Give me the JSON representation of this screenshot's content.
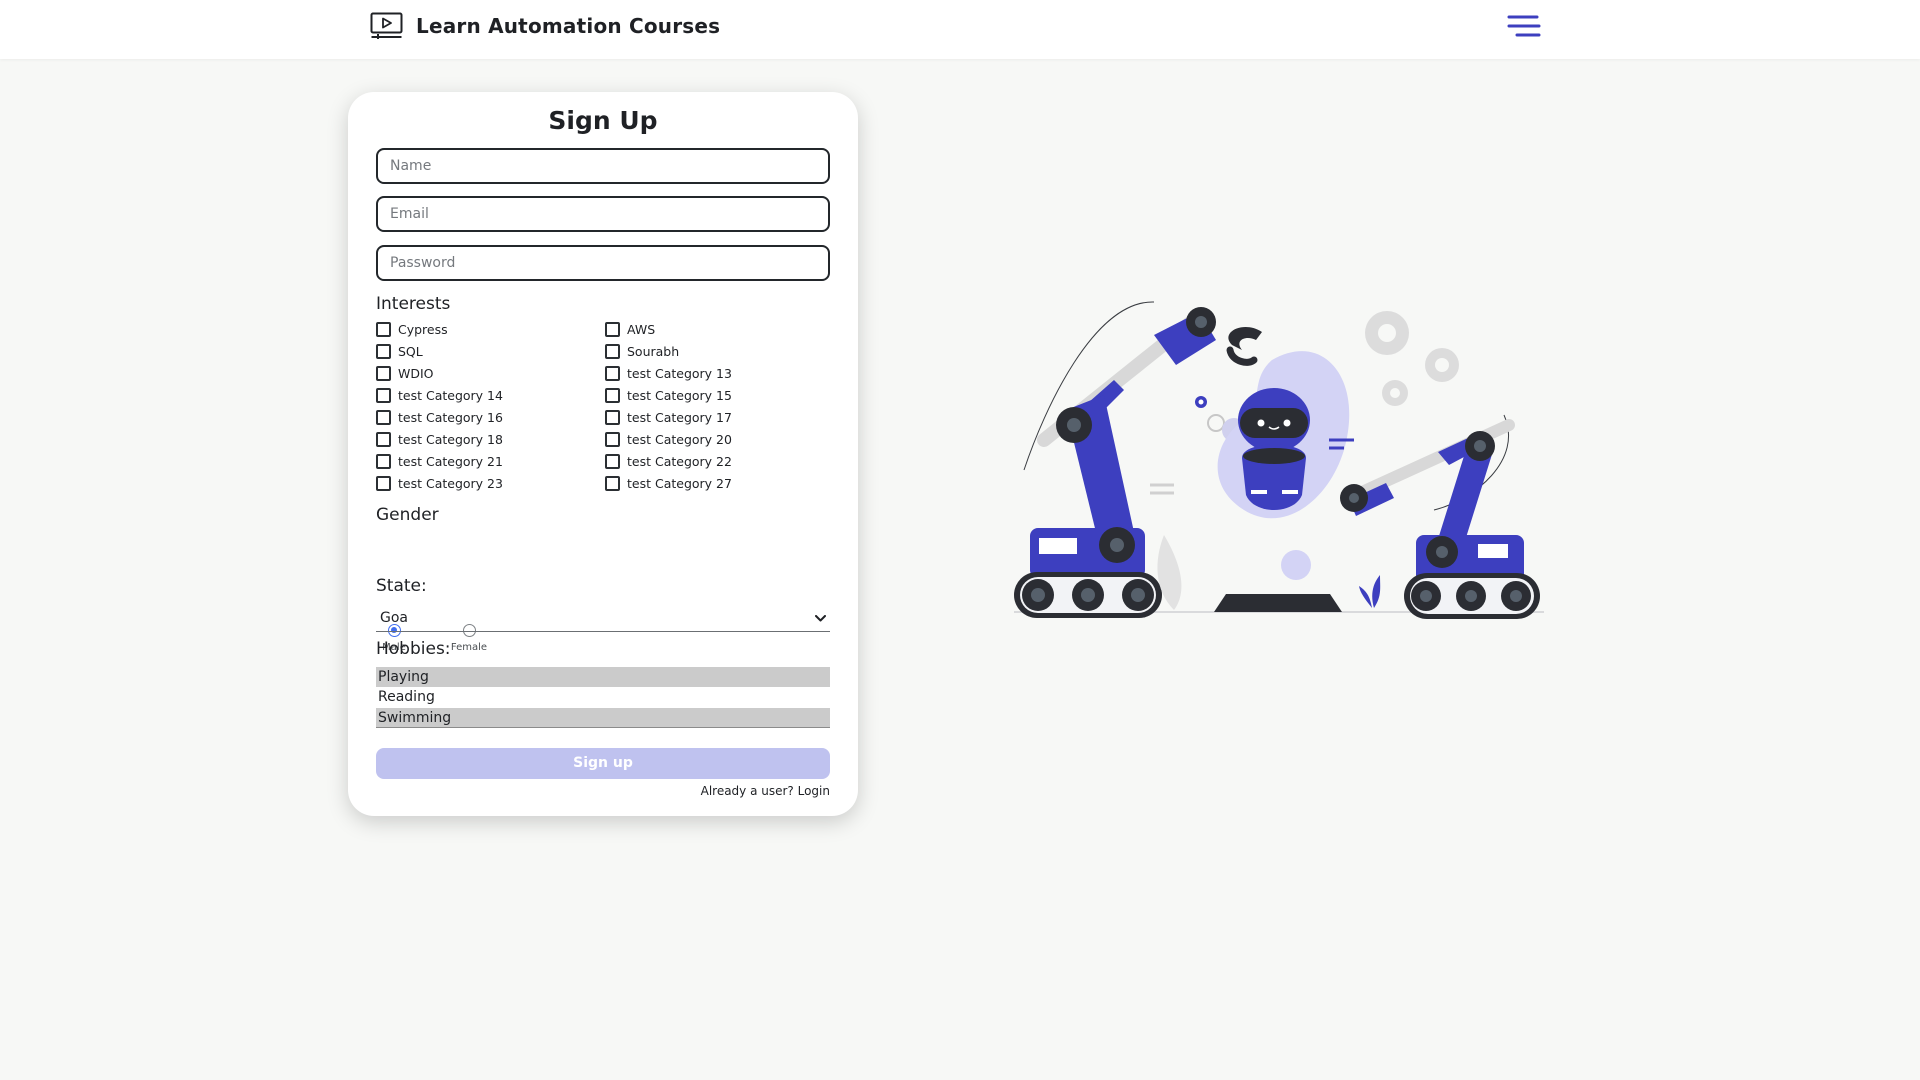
{
  "header": {
    "brand_title": "Learn Automation Courses",
    "brand_icon": "video-screen-icon",
    "menu_icon": "hamburger-icon",
    "accent_color": "#3d3fbf"
  },
  "signup": {
    "title": "Sign Up",
    "name_placeholder": "Name",
    "email_placeholder": "Email",
    "password_placeholder": "Password",
    "interests_label": "Interests",
    "interests": [
      {
        "label": "Cypress",
        "checked": false
      },
      {
        "label": "AWS",
        "checked": false
      },
      {
        "label": "SQL",
        "checked": false
      },
      {
        "label": "Sourabh",
        "checked": false
      },
      {
        "label": "WDIO",
        "checked": false
      },
      {
        "label": "test Category 13",
        "checked": false
      },
      {
        "label": "test Category 14",
        "checked": false
      },
      {
        "label": "test Category 15",
        "checked": false
      },
      {
        "label": "test Category 16",
        "checked": false
      },
      {
        "label": "test Category 17",
        "checked": false
      },
      {
        "label": "test Category 18",
        "checked": false
      },
      {
        "label": "test Category 20",
        "checked": false
      },
      {
        "label": "test Category 21",
        "checked": false
      },
      {
        "label": "test Category 22",
        "checked": false
      },
      {
        "label": "test Category 23",
        "checked": false
      },
      {
        "label": "test Category 27",
        "checked": false
      }
    ],
    "gender_label": "Gender",
    "gender_options": [
      {
        "label": "Male",
        "selected": true
      },
      {
        "label": "Female",
        "selected": false
      }
    ],
    "state_label": "State:",
    "state_value": "Goa",
    "hobbies_label": "Hobbies:",
    "hobbies": [
      {
        "label": "Playing",
        "selected": true
      },
      {
        "label": "Reading",
        "selected": false
      },
      {
        "label": "Swimming",
        "selected": true
      }
    ],
    "submit_label": "Sign up",
    "login_link": "Already a user? Login"
  },
  "illustration": {
    "name": "robot-arms-illustration",
    "primary_color": "#3d3fbf",
    "secondary_color": "#d3d3f5"
  }
}
